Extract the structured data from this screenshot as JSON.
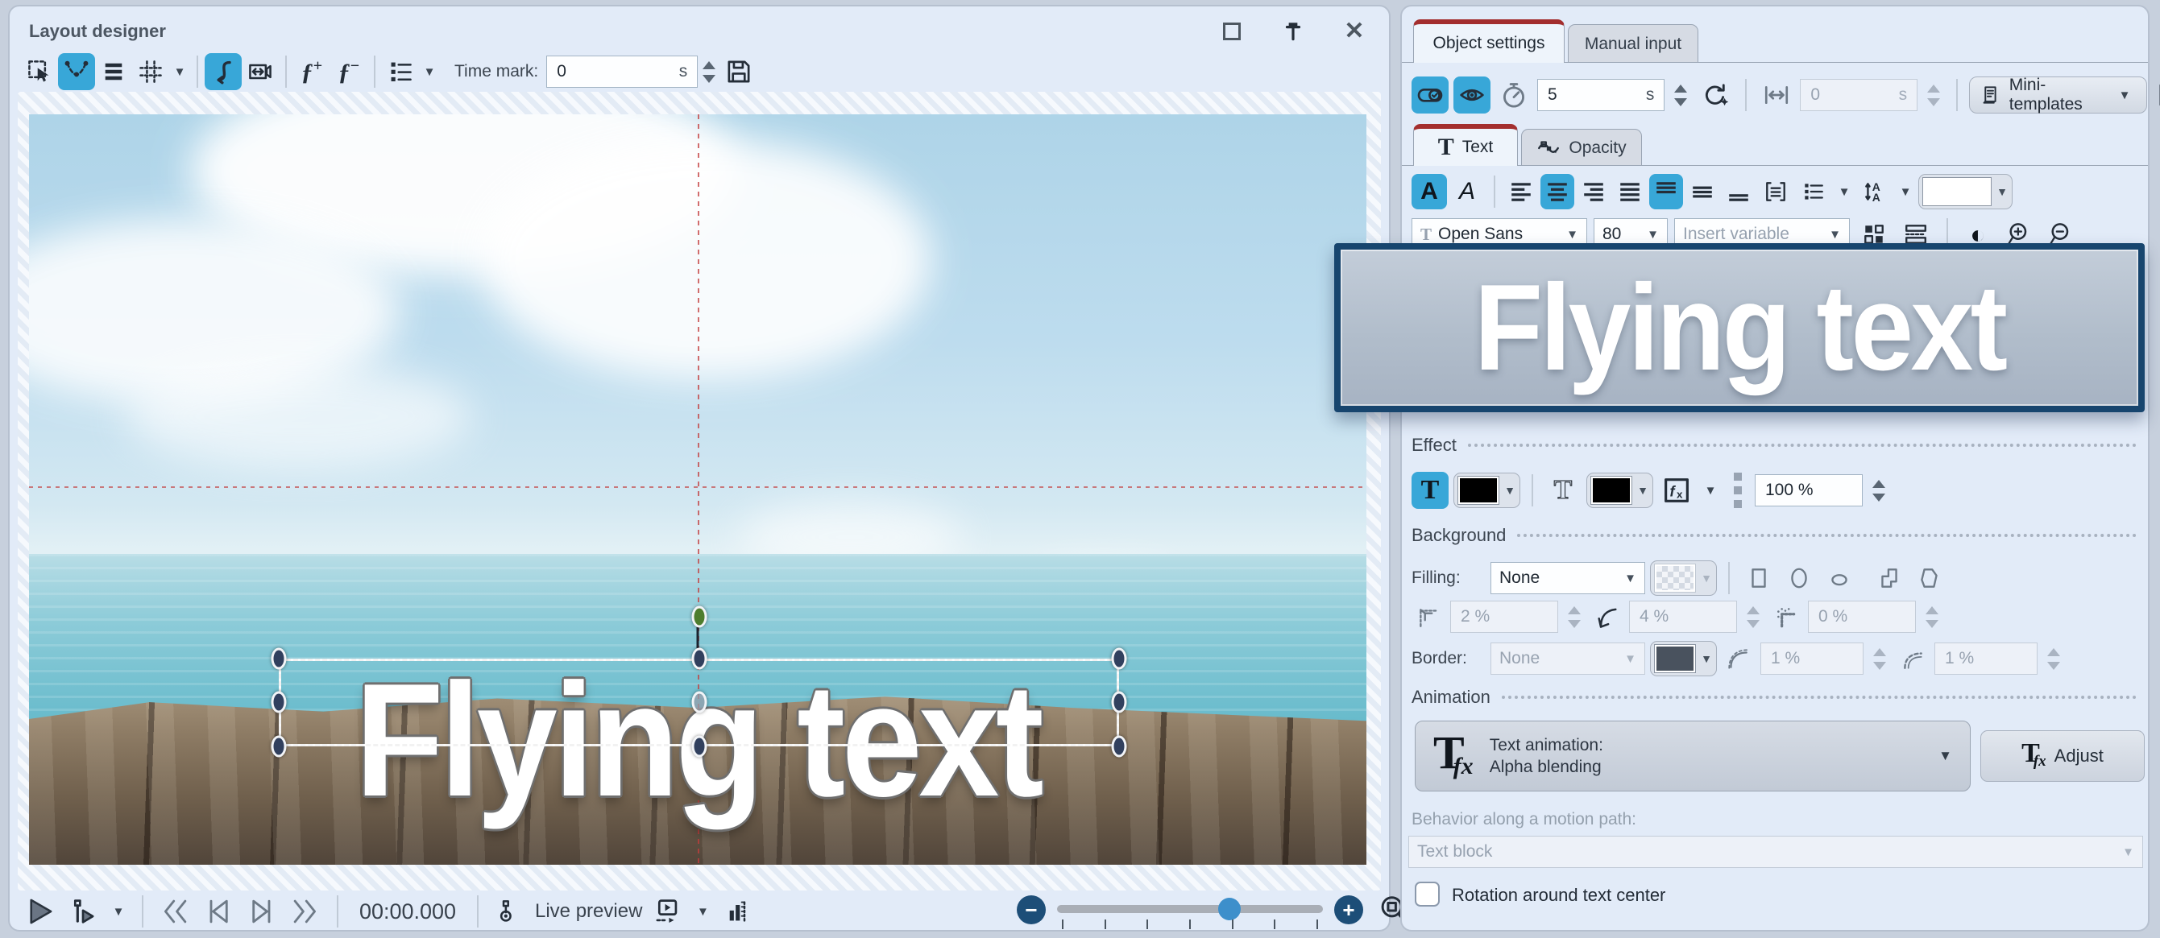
{
  "left_panel": {
    "title": "Layout designer",
    "time_mark_label": "Time mark:",
    "time_mark_value": "0",
    "time_mark_unit": "s",
    "canvas_text": "Flying text",
    "time_display": "00:00.000",
    "live_preview_label": "Live preview"
  },
  "right_panel": {
    "tabs": {
      "object_settings": "Object settings",
      "manual_input": "Manual input"
    },
    "duration_value": "5",
    "duration_unit": "s",
    "offset_value": "0",
    "offset_unit": "s",
    "mini_templates_label": "Mini-templates",
    "sub_tabs": {
      "text": "Text",
      "opacity": "Opacity"
    },
    "text_tab_glyph": "T",
    "font_name": "Open Sans",
    "font_size": "80",
    "insert_variable_placeholder": "Insert variable",
    "editor_text": "Flying text",
    "effect": {
      "header": "Effect",
      "opacity_value": "100 %"
    },
    "background": {
      "header": "Background",
      "filling_label": "Filling:",
      "filling_value": "None",
      "inner_margin": "2 %",
      "corner_value": "4 %",
      "soft_edge": "0 %",
      "border_label": "Border:",
      "border_value": "None",
      "border_width": "1 %",
      "border_radius": "1 %"
    },
    "animation": {
      "header": "Animation",
      "type_label": "Text animation:",
      "type_value": "Alpha blending",
      "adjust_label": "Adjust",
      "behavior_label": "Behavior along a motion path:",
      "behavior_value": "Text block",
      "rotation_label": "Rotation around text center"
    }
  },
  "colors": {
    "accent_blue": "#38a7d8",
    "tab_accent_red": "#a32e2e",
    "editor_border_navy": "#17456e",
    "guide_red": "#c33c3c",
    "handle_navy": "#31405e",
    "handle_green": "#4e7d2e",
    "panel_background": "#e2ebf8"
  }
}
